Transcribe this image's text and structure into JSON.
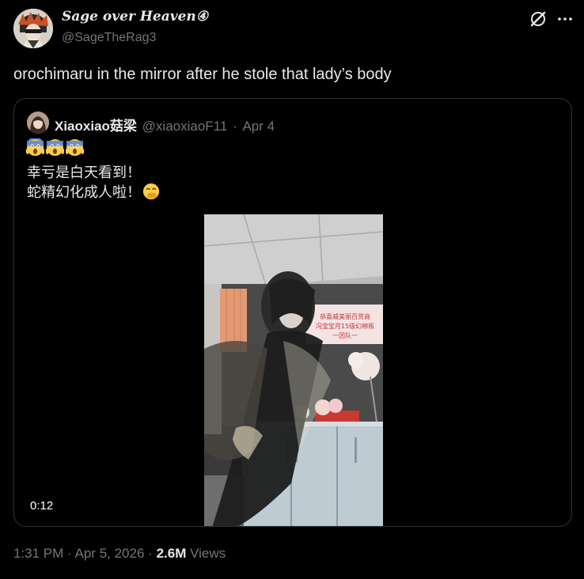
{
  "author": {
    "display_name": "Sage over Heaven④",
    "handle": "@SageTheRag3"
  },
  "tweet": {
    "text": "orochimaru in the mirror after he stole that lady’s body"
  },
  "header_actions": {
    "grok_icon": "grok-icon",
    "more_icon": "more-dots-icon"
  },
  "quote": {
    "name": "Xiaoxiao菇梁",
    "handle": "@xiaoxiaoF11",
    "separator": "·",
    "date": "Apr 4",
    "emoji_line": [
      "face-screaming-in-fear",
      "face-screaming-in-fear",
      "face-screaming-in-fear"
    ],
    "line2": "幸亏是白天看到！",
    "line3": "蛇精幻化成人啦！",
    "line3_emoji": "face-with-hand-over-mouth",
    "video": {
      "duration": "0:12",
      "banner_lines": [
        "恭喜威美丽百货商",
        "冯宝宝月15级幻棉瓶",
        "一团队一"
      ]
    }
  },
  "meta": {
    "time": "1:31 PM",
    "date": "Apr 5, 2026",
    "separator": "·",
    "view_count": "2.6M",
    "views_label": "Views"
  },
  "colors": {
    "background": "#000000",
    "primary_text": "#e7e9ea",
    "secondary_text": "#71767b",
    "border": "#2f3336"
  }
}
